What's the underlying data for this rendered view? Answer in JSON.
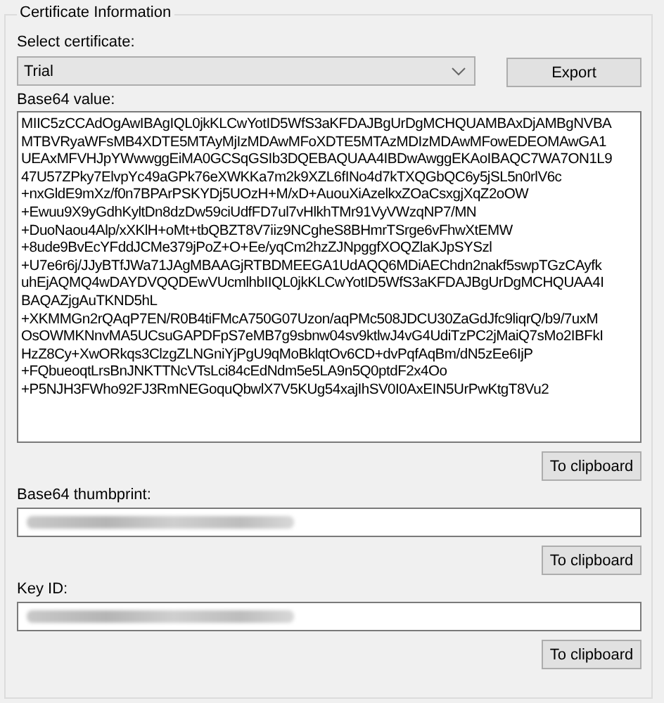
{
  "group": {
    "title": "Certificate Information"
  },
  "certificate_select": {
    "label": "Select certificate:",
    "value": "Trial"
  },
  "export_button": "Export",
  "sections": [
    {
      "label": "Base64 value:",
      "kind": "multiline",
      "value": "MIIC5zCCAdOgAwIBAgIQL0jkKLCwYotID5WfS3aKFDAJBgUrDgMCHQUAMBAxDjAMBgNVBA\nMTBVRyaWFsMB4XDTE5MTAyMjIzMDAwMFoXDTE5MTAzMDIzMDAwMFowEDEOMAwGA1\nUEAxMFVHJpYWwwggEiMA0GCSqGSIb3DQEBAQUAA4IBDwAwggEKAoIBAQC7WA7ON1L9\n47U57ZPky7ElvpYc49aGPk76eXWKKa7m2k9XZL6fINo4d7kTXQGbQC6y5jSL5n0rlV6c\n+nxGldE9mXz/f0n7BPArPSKYDj5UOzH+M/xD+AuouXiAzelkxZOaCsxgjXqZ2oOW\n+Ewuu9X9yGdhKyltDn8dzDw59ciUdfFD7ul7vHlkhTMr91VyVWzqNP7/MN\n+DuoNaou4Alp/xXKlH+oMt+tbQBZT8V7iiz9NCgheS8BHmrTSrge6vFhwXtEMW\n+8ude9BvEcYFddJCMe379jPoZ+O+Ee/yqCm2hzZJNpggfXOQZlaKJpSYSzl\n+U7e6r6j/JJyBTfJWa71JAgMBAAGjRTBDMEEGA1UdAQQ6MDiAEChdn2nakf5swpTGzCAyfk\nuhEjAQMQ4wDAYDVQQDEwVUcmlhbIIQL0jkKLCwYotID5WfS3aKFDAJBgUrDgMCHQUAA4I\nBAQAZjgAuTKND5hL\n+XKMMGn2rQAqP7EN/R0B4tiFMcA750G07Uzon/aqPMc508JDCU30ZaGdJfc9liqrQ/b9/7uxM\nOsOWMKNnvMA5UCsuGAPDFpS7eMB7g9sbnw04sv9ktlwJ4vG4UdiTzPC2jMaiQ7sMo2IBFkI\nHzZ8Cy+XwORkqs3ClzgZLNGniYjPgU9qMoBklqtOv6CD+dvPqfAqBm/dN5zEe6IjP\n+FQbueoqtLrsBnJNKTTNcVTsLci84cEdNdm5e5LA9n5Q0ptdF2x4Oo\n+P5NJH3FWho92FJ3RmNEGoquQbwlX7V5KUg54xajIhSV0I0AxEIN5UrPwKtgT8Vu2",
      "button": "To clipboard"
    },
    {
      "label": "Base64 thumbprint:",
      "kind": "redacted",
      "button": "To clipboard"
    },
    {
      "label": "Key ID:",
      "kind": "redacted",
      "button": "To clipboard"
    }
  ]
}
